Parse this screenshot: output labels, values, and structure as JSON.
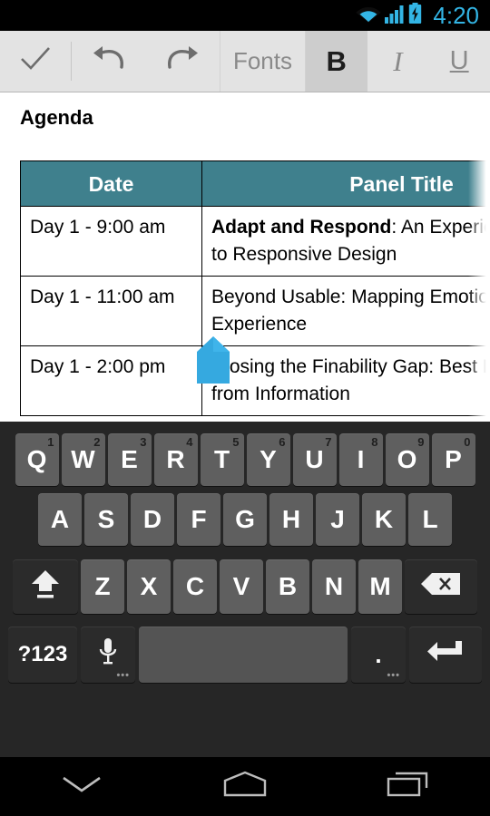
{
  "status_bar": {
    "time": "4:20",
    "accent_color": "#33b5e5",
    "icons": [
      "wifi-icon",
      "cellular-signal-icon",
      "battery-charging-icon"
    ]
  },
  "toolbar": {
    "background": "#e3e3e3",
    "done_label": "",
    "undo_label": "",
    "redo_label": "",
    "fonts_label": "Fonts",
    "bold_label": "B",
    "italic_label": "I",
    "underline_label": "U",
    "bold_active": true
  },
  "document": {
    "title": "Agenda",
    "table": {
      "header_background": "#3f808d",
      "columns": [
        "Date",
        "Panel Title"
      ],
      "rows": [
        {
          "date": "Day 1 - 9:00 am",
          "panel_bold": "Adapt and Respond",
          "panel_rest": ": An Experience Guide to Responsive Design"
        },
        {
          "date": "Day 1 - 11:00 am",
          "panel_bold": "",
          "panel_rest": "Beyond Usable: Mapping Emotion to Experience"
        },
        {
          "date": "Day 1 - 2:00 pm",
          "panel_bold": "",
          "panel_rest": "Closing the Finability Gap: Best Practices from Information"
        }
      ]
    }
  },
  "cursor_handle": {
    "color": "#35a9e0"
  },
  "keyboard": {
    "background": "#262626",
    "row1": [
      {
        "label": "Q",
        "num": "1"
      },
      {
        "label": "W",
        "num": "2"
      },
      {
        "label": "E",
        "num": "3"
      },
      {
        "label": "R",
        "num": "4"
      },
      {
        "label": "T",
        "num": "5"
      },
      {
        "label": "Y",
        "num": "6"
      },
      {
        "label": "U",
        "num": "7"
      },
      {
        "label": "I",
        "num": "8"
      },
      {
        "label": "O",
        "num": "9"
      },
      {
        "label": "P",
        "num": "0"
      }
    ],
    "row2": [
      {
        "label": "A"
      },
      {
        "label": "S"
      },
      {
        "label": "D"
      },
      {
        "label": "F"
      },
      {
        "label": "G"
      },
      {
        "label": "H"
      },
      {
        "label": "J"
      },
      {
        "label": "K"
      },
      {
        "label": "L"
      }
    ],
    "row3": [
      {
        "label": "Z"
      },
      {
        "label": "X"
      },
      {
        "label": "C"
      },
      {
        "label": "V"
      },
      {
        "label": "B"
      },
      {
        "label": "N"
      },
      {
        "label": "M"
      }
    ],
    "shift_label": "",
    "backspace_label": "",
    "symbols_label": "?123",
    "mic_label": "",
    "space_label": "",
    "period_label": ".",
    "enter_label": ""
  },
  "navbar": {
    "back_label": "",
    "home_label": "",
    "recents_label": ""
  }
}
